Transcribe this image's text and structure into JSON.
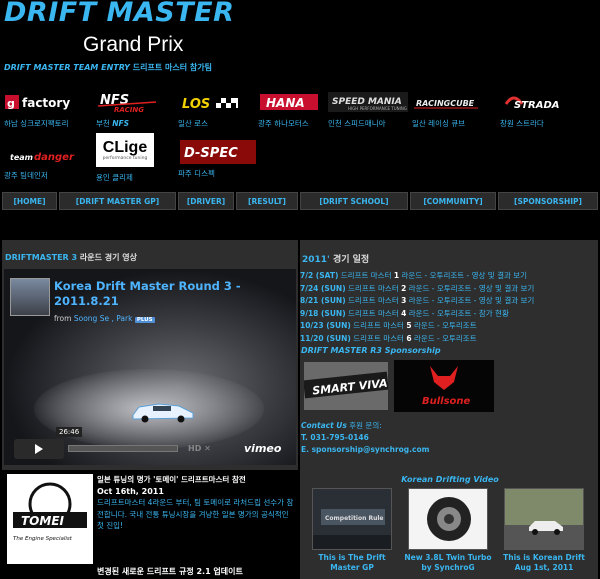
{
  "header": {
    "title": "DRIFT MASTER",
    "subtitle": "Grand Prix"
  },
  "entry": {
    "heading_en": "DRIFT MASTER TEAM ENTRY",
    "heading_kr": "드리프트 마스터 참가팀"
  },
  "teams": [
    {
      "logo_text": "G-factory",
      "caption": "하남 싱크로지팩토리"
    },
    {
      "logo_text": "NFS RACING",
      "caption": "부천 NFS"
    },
    {
      "logo_text": "LOS",
      "caption": "일산 로스"
    },
    {
      "logo_text": "HANA",
      "caption": "광주 하나모터스"
    },
    {
      "logo_text": "SPEED MANIA",
      "caption": "인천 스피드매니아"
    },
    {
      "logo_text": "RACING CUBE",
      "caption": "일산 레이싱 큐브"
    },
    {
      "logo_text": "STRADA",
      "caption": "창원 스트라다"
    },
    {
      "logo_text": "team danger",
      "caption": "광주 팀데인저"
    },
    {
      "logo_text": "CLige",
      "logo_sub": "performance tuning",
      "caption": "용인 클리제"
    },
    {
      "logo_text": "D-SPEC",
      "caption": "파주 디스펙"
    }
  ],
  "nav": [
    "[HOME]",
    "[DRIFT MASTER GP]",
    "[DRIVER]",
    "[RESULT]",
    "[DRIFT SCHOOL]",
    "[COMMUNITY]",
    "[SPONSORSHIP]"
  ],
  "left_panel": {
    "title_en": "DRIFTMASTER 3",
    "title_kr": "라운드 경기 영상"
  },
  "video": {
    "title": "Korea Drift Master Round 3 - 2011.8.21",
    "from_label": "from",
    "user": "Soong Se , Park",
    "badge": "PLUS",
    "duration": "26:46",
    "hd": "HD ✕",
    "brand": "vimeo"
  },
  "schedule": {
    "title_en": "2011'",
    "title_kr": "경기 일정",
    "items": [
      {
        "date": "7/2  (SAT)",
        "text": "드리프트 마스터",
        "round": "1",
        "rest": "라운드 - 오투리조트 - 영상 및 결과 보기"
      },
      {
        "date": "7/24 (SUN)",
        "text": "드리프트 마스터",
        "round": "2",
        "rest": "라운드 - 오투리조트 - 영상 및 결과 보기"
      },
      {
        "date": "8/21 (SUN)",
        "text": "드리프트 마스터",
        "round": "3",
        "rest": "라운드 - 오투리조트 - 영상 및 결과 보기"
      },
      {
        "date": "9/18 (SUN)",
        "text": "드리프트 마스터",
        "round": "4",
        "rest": "라운드 - 오투리조트 - 참가 현황"
      },
      {
        "date": "10/23 (SUN)",
        "text": "드리프트 마스터",
        "round": "5",
        "rest": "라운드 - 오투리조트"
      },
      {
        "date": "11/20 (SUN)",
        "text": "드리프트 마스터",
        "round": "6",
        "rest": "라운드 - 오투리조트"
      }
    ]
  },
  "sponsor": {
    "title": "DRIFT MASTER R3 Sponsorship",
    "logo1": "SMART VIVA",
    "logo2": "Bullsone"
  },
  "contact": {
    "label": "Contact Us",
    "label_kr": "후원 문의:",
    "phone": "T. 031-795-0146",
    "email": "E. sponsorship@synchrog.com"
  },
  "news": {
    "thumb_logo": "TOMEI",
    "thumb_tag": "The Engine Specialist",
    "title": "일본 튜닝의 명가 '토메이' 드리프트마스터 참전",
    "date": "Oct 16th, 2011",
    "body": "드리프트마스터 4라운드 부터, 팀 토메이로 라처드립 선수가 참전합니다. 국내 전통 튜닝시장을 겨냥한 일본 명가의 공식적인 첫 진입!",
    "next_title": "변경된 새로운 드리프트 규정 2.1 업데이트"
  },
  "korean_video": {
    "title": "Korean Drifting Video",
    "items": [
      {
        "caption": "This is The Drift Master GP"
      },
      {
        "caption": "New 3.8L Twin Turbo by SynchroG"
      },
      {
        "caption": "This is Korean Drift Aug 1st, 2011"
      }
    ]
  }
}
